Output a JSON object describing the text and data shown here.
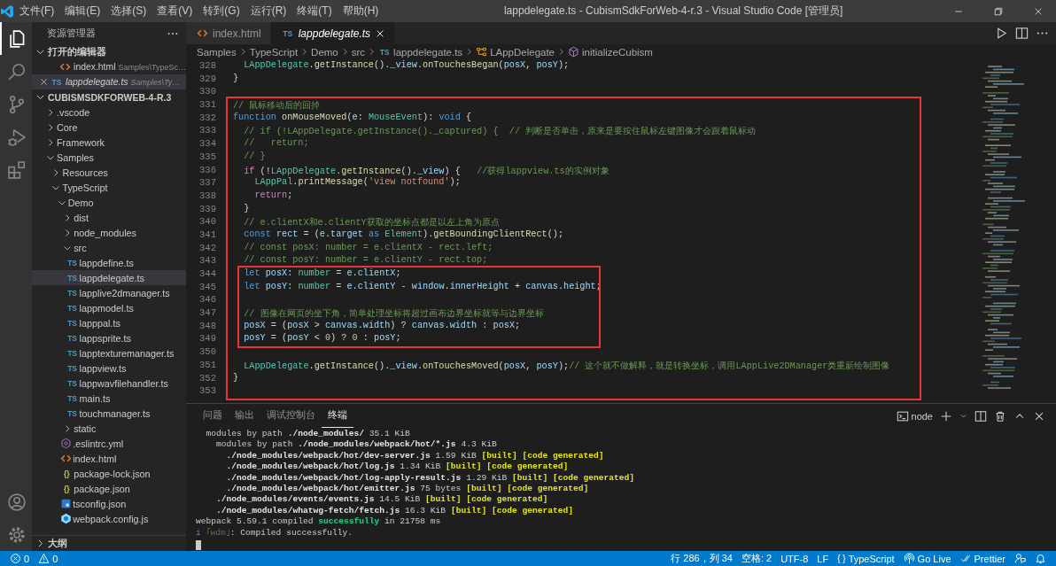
{
  "window": {
    "title": "lappdelegate.ts - CubismSdkForWeb-4-r.3 - Visual Studio Code [管理员]"
  },
  "menu": [
    "文件(F)",
    "编辑(E)",
    "选择(S)",
    "查看(V)",
    "转到(G)",
    "运行(R)",
    "终端(T)",
    "帮助(H)"
  ],
  "activity_bar": {
    "top": [
      {
        "kind": "explorer",
        "selected": true
      },
      {
        "kind": "search",
        "selected": false
      },
      {
        "kind": "scm",
        "selected": false
      },
      {
        "kind": "debug",
        "selected": false
      },
      {
        "kind": "extensions",
        "selected": false
      }
    ],
    "bottom": [
      {
        "kind": "account"
      },
      {
        "kind": "settings"
      }
    ]
  },
  "sidebar": {
    "title": "资源管理器",
    "open_editors": {
      "title": "打开的编辑器",
      "expanded": true,
      "items": [
        {
          "label": "index.html",
          "description": "Samples\\TypeSc…",
          "kind": "html",
          "preview": false,
          "selected": false
        },
        {
          "label": "lappdelegate.ts",
          "description": "Samples\\Ty…",
          "kind": "ts",
          "icon_label": "TS",
          "preview": true,
          "selected": true
        }
      ]
    },
    "folder": {
      "title": "CUBISMSDKFORWEB-4-R.3",
      "expanded": true,
      "tree": [
        {
          "label": ".vscode",
          "kind": "folder",
          "expanded": false,
          "selected": false
        },
        {
          "label": "Core",
          "kind": "folder",
          "expanded": false,
          "selected": false
        },
        {
          "label": "Framework",
          "kind": "folder",
          "expanded": false,
          "selected": false
        },
        {
          "label": "Samples",
          "kind": "folder",
          "expanded": true,
          "selected": false,
          "children": [
            {
              "label": "Resources",
              "kind": "folder",
              "expanded": false,
              "selected": false
            },
            {
              "label": "TypeScript",
              "kind": "folder",
              "expanded": true,
              "selected": false,
              "children": [
                {
                  "label": "Demo",
                  "kind": "folder",
                  "expanded": true,
                  "selected": false,
                  "children": [
                    {
                      "label": "dist",
                      "kind": "folder",
                      "expanded": false,
                      "selected": false
                    },
                    {
                      "label": "node_modules",
                      "kind": "folder",
                      "expanded": false,
                      "selected": false
                    },
                    {
                      "label": "src",
                      "kind": "folder",
                      "expanded": true,
                      "selected": false,
                      "children": [
                        {
                          "label": "lappdefine.ts",
                          "kind": "ts",
                          "icon_label": "TS",
                          "selected": false
                        },
                        {
                          "label": "lappdelegate.ts",
                          "kind": "ts",
                          "icon_label": "TS",
                          "selected": true
                        },
                        {
                          "label": "lapplive2dmanager.ts",
                          "kind": "ts",
                          "icon_label": "TS",
                          "selected": false
                        },
                        {
                          "label": "lappmodel.ts",
                          "kind": "ts",
                          "icon_label": "TS",
                          "selected": false
                        },
                        {
                          "label": "lapppal.ts",
                          "kind": "ts",
                          "icon_label": "TS",
                          "selected": false
                        },
                        {
                          "label": "lappsprite.ts",
                          "kind": "ts",
                          "icon_label": "TS",
                          "selected": false
                        },
                        {
                          "label": "lapptexturemanager.ts",
                          "kind": "ts",
                          "icon_label": "TS",
                          "selected": false
                        },
                        {
                          "label": "lappview.ts",
                          "kind": "ts",
                          "icon_label": "TS",
                          "selected": false
                        },
                        {
                          "label": "lappwavfilehandler.ts",
                          "kind": "ts",
                          "icon_label": "TS",
                          "selected": false
                        },
                        {
                          "label": "main.ts",
                          "kind": "ts",
                          "icon_label": "TS",
                          "selected": false
                        },
                        {
                          "label": "touchmanager.ts",
                          "kind": "ts",
                          "icon_label": "TS",
                          "selected": false
                        }
                      ]
                    },
                    {
                      "label": "static",
                      "kind": "folder",
                      "expanded": false,
                      "selected": false
                    },
                    {
                      "label": ".eslintrc.yml",
                      "kind": "yml",
                      "selected": false
                    },
                    {
                      "label": "index.html",
                      "kind": "html",
                      "selected": false
                    },
                    {
                      "label": "package-lock.json",
                      "kind": "json",
                      "icon_label": "{}",
                      "selected": false
                    },
                    {
                      "label": "package.json",
                      "kind": "json",
                      "icon_label": "{}",
                      "selected": false
                    },
                    {
                      "label": "tsconfig.json",
                      "kind": "tsconfig",
                      "selected": false
                    },
                    {
                      "label": "webpack.config.js",
                      "kind": "webpack",
                      "selected": false
                    }
                  ]
                }
              ]
            }
          ]
        }
      ]
    },
    "outline": {
      "title": "大纲",
      "expanded": false
    }
  },
  "editor": {
    "tabs": [
      {
        "label": "index.html",
        "kind": "html",
        "preview": false,
        "selected": false
      },
      {
        "label": "lappdelegate.ts",
        "kind": "ts",
        "icon_label": "TS",
        "preview": true,
        "selected": true
      }
    ],
    "breadcrumb": [
      {
        "label": "Samples",
        "kind": "path"
      },
      {
        "label": "TypeScript",
        "kind": "path"
      },
      {
        "label": "Demo",
        "kind": "path"
      },
      {
        "label": "src",
        "kind": "path"
      },
      {
        "label": "lappdelegate.ts",
        "kind": "ts",
        "icon_label": "TS"
      },
      {
        "label": "LAppDelegate",
        "kind": "class"
      },
      {
        "label": "initializeCubism",
        "kind": "method"
      }
    ],
    "code": [
      {
        "kind": "line",
        "number": "328",
        "tokens": [
          {
            "kind": "type",
            "text": "  LAppDelegate"
          },
          {
            "kind": "plain",
            "text": "."
          },
          {
            "kind": "function",
            "text": "getInstance"
          },
          {
            "kind": "plain",
            "text": "()."
          },
          {
            "kind": "variable",
            "text": "_view"
          },
          {
            "kind": "plain",
            "text": "."
          },
          {
            "kind": "function",
            "text": "onTouchesBegan"
          },
          {
            "kind": "plain",
            "text": "("
          },
          {
            "kind": "variable",
            "text": "posX"
          },
          {
            "kind": "plain",
            "text": ", "
          },
          {
            "kind": "variable",
            "text": "posY"
          },
          {
            "kind": "plain",
            "text": ");"
          }
        ]
      },
      {
        "kind": "line",
        "number": "329",
        "tokens": [
          {
            "kind": "plain",
            "text": "}"
          }
        ]
      },
      {
        "kind": "line",
        "number": "330"
      },
      {
        "kind": "box",
        "items": [
          {
            "kind": "line",
            "number": "331",
            "tokens": [
              {
                "kind": "comment",
                "text": "// 鼠标移动后的回掉"
              }
            ]
          },
          {
            "kind": "line",
            "number": "332",
            "tokens": [
              {
                "kind": "keyword",
                "text": "function"
              },
              {
                "kind": "function",
                "text": " onMouseMoved"
              },
              {
                "kind": "plain",
                "text": "("
              },
              {
                "kind": "variable",
                "text": "e"
              },
              {
                "kind": "plain",
                "text": ": "
              },
              {
                "kind": "type",
                "text": "MouseEvent"
              },
              {
                "kind": "plain",
                "text": "): "
              },
              {
                "kind": "keyword",
                "text": "void"
              },
              {
                "kind": "plain",
                "text": " {"
              }
            ]
          },
          {
            "kind": "line",
            "number": "333",
            "tokens": [
              {
                "kind": "comment",
                "text": "  // if (!LAppDelegate.getInstance()._captured) {  // 判断是否单击，原来是要按住鼠标左键图像才会跟着鼠标动"
              }
            ]
          },
          {
            "kind": "line",
            "number": "334",
            "tokens": [
              {
                "kind": "comment",
                "text": "  //   return;"
              }
            ]
          },
          {
            "kind": "line",
            "number": "335",
            "tokens": [
              {
                "kind": "comment",
                "text": "  // }"
              }
            ]
          },
          {
            "kind": "line",
            "number": "336",
            "tokens": [
              {
                "kind": "control",
                "text": "  if"
              },
              {
                "kind": "plain",
                "text": " (!"
              },
              {
                "kind": "type",
                "text": "LAppDelegate"
              },
              {
                "kind": "plain",
                "text": "."
              },
              {
                "kind": "function",
                "text": "getInstance"
              },
              {
                "kind": "plain",
                "text": "()."
              },
              {
                "kind": "variable",
                "text": "_view"
              },
              {
                "kind": "plain",
                "text": ") {   "
              },
              {
                "kind": "comment",
                "text": "//获得lappview.ts的实例对象"
              }
            ]
          },
          {
            "kind": "line",
            "number": "337",
            "tokens": [
              {
                "kind": "type",
                "text": "    LAppPal"
              },
              {
                "kind": "plain",
                "text": "."
              },
              {
                "kind": "function",
                "text": "printMessage"
              },
              {
                "kind": "plain",
                "text": "("
              },
              {
                "kind": "string",
                "text": "'view notfound'"
              },
              {
                "kind": "plain",
                "text": ");"
              }
            ]
          },
          {
            "kind": "line",
            "number": "338",
            "tokens": [
              {
                "kind": "control",
                "text": "    return"
              },
              {
                "kind": "plain",
                "text": ";"
              }
            ]
          },
          {
            "kind": "line",
            "number": "339",
            "tokens": [
              {
                "kind": "plain",
                "text": "  }"
              }
            ]
          },
          {
            "kind": "line",
            "number": "340",
            "tokens": [
              {
                "kind": "comment",
                "text": "  // e.clientX和e.clientY获取的坐标点都是以左上角为原点"
              }
            ]
          },
          {
            "kind": "line",
            "number": "341",
            "tokens": [
              {
                "kind": "keyword",
                "text": "  const"
              },
              {
                "kind": "variable",
                "text": " rect"
              },
              {
                "kind": "plain",
                "text": " = ("
              },
              {
                "kind": "variable",
                "text": "e"
              },
              {
                "kind": "plain",
                "text": "."
              },
              {
                "kind": "variable",
                "text": "target"
              },
              {
                "kind": "keyword",
                "text": " as"
              },
              {
                "kind": "type",
                "text": " Element"
              },
              {
                "kind": "plain",
                "text": ")."
              },
              {
                "kind": "function",
                "text": "getBoundingClientRect"
              },
              {
                "kind": "plain",
                "text": "();"
              }
            ]
          },
          {
            "kind": "line",
            "number": "342",
            "tokens": [
              {
                "kind": "comment",
                "text": "  // const posX: number = e.clientX - rect.left;"
              }
            ]
          },
          {
            "kind": "line",
            "number": "343",
            "tokens": [
              {
                "kind": "comment",
                "text": "  // const posY: number = e.clientY - rect.top;"
              }
            ]
          },
          {
            "kind": "box",
            "items": [
              {
                "kind": "line",
                "number": "344",
                "tokens": [
                  {
                    "kind": "keyword",
                    "text": "  let"
                  },
                  {
                    "kind": "variable",
                    "text": " posX"
                  },
                  {
                    "kind": "plain",
                    "text": ": "
                  },
                  {
                    "kind": "type",
                    "text": "number"
                  },
                  {
                    "kind": "plain",
                    "text": " = "
                  },
                  {
                    "kind": "variable",
                    "text": "e"
                  },
                  {
                    "kind": "plain",
                    "text": "."
                  },
                  {
                    "kind": "variable",
                    "text": "clientX"
                  },
                  {
                    "kind": "plain",
                    "text": ";"
                  }
                ]
              },
              {
                "kind": "line",
                "number": "345",
                "tokens": [
                  {
                    "kind": "keyword",
                    "text": "  let"
                  },
                  {
                    "kind": "variable",
                    "text": " posY"
                  },
                  {
                    "kind": "plain",
                    "text": ": "
                  },
                  {
                    "kind": "type",
                    "text": "number"
                  },
                  {
                    "kind": "plain",
                    "text": " = "
                  },
                  {
                    "kind": "variable",
                    "text": "e"
                  },
                  {
                    "kind": "plain",
                    "text": "."
                  },
                  {
                    "kind": "variable",
                    "text": "clientY"
                  },
                  {
                    "kind": "plain",
                    "text": " - "
                  },
                  {
                    "kind": "variable",
                    "text": "window"
                  },
                  {
                    "kind": "plain",
                    "text": "."
                  },
                  {
                    "kind": "variable",
                    "text": "innerHeight"
                  },
                  {
                    "kind": "plain",
                    "text": " + "
                  },
                  {
                    "kind": "variable",
                    "text": "canvas"
                  },
                  {
                    "kind": "plain",
                    "text": "."
                  },
                  {
                    "kind": "variable",
                    "text": "height"
                  },
                  {
                    "kind": "plain",
                    "text": ";"
                  }
                ]
              },
              {
                "kind": "line",
                "number": "346"
              },
              {
                "kind": "line",
                "number": "347",
                "tokens": [
                  {
                    "kind": "comment",
                    "text": "  // 图像在网页的坐下角，简单处理坐标将超过画布边界坐标就等与边界坐标"
                  }
                ]
              },
              {
                "kind": "line",
                "number": "348",
                "tokens": [
                  {
                    "kind": "variable",
                    "text": "  posX"
                  },
                  {
                    "kind": "plain",
                    "text": " = ("
                  },
                  {
                    "kind": "variable",
                    "text": "posX"
                  },
                  {
                    "kind": "plain",
                    "text": " > "
                  },
                  {
                    "kind": "variable",
                    "text": "canvas"
                  },
                  {
                    "kind": "plain",
                    "text": "."
                  },
                  {
                    "kind": "variable",
                    "text": "width"
                  },
                  {
                    "kind": "plain",
                    "text": ") ? "
                  },
                  {
                    "kind": "variable",
                    "text": "canvas"
                  },
                  {
                    "kind": "plain",
                    "text": "."
                  },
                  {
                    "kind": "variable",
                    "text": "width"
                  },
                  {
                    "kind": "plain",
                    "text": " : "
                  },
                  {
                    "kind": "variable",
                    "text": "posX"
                  },
                  {
                    "kind": "plain",
                    "text": ";"
                  }
                ]
              },
              {
                "kind": "line",
                "number": "349",
                "tokens": [
                  {
                    "kind": "variable",
                    "text": "  posY"
                  },
                  {
                    "kind": "plain",
                    "text": " = ("
                  },
                  {
                    "kind": "variable",
                    "text": "posY"
                  },
                  {
                    "kind": "plain",
                    "text": " < "
                  },
                  {
                    "kind": "number",
                    "text": "0"
                  },
                  {
                    "kind": "plain",
                    "text": ") ? "
                  },
                  {
                    "kind": "number",
                    "text": "0"
                  },
                  {
                    "kind": "plain",
                    "text": " : "
                  },
                  {
                    "kind": "variable",
                    "text": "posY"
                  },
                  {
                    "kind": "plain",
                    "text": ";"
                  }
                ]
              }
            ]
          },
          {
            "kind": "line",
            "number": "350"
          },
          {
            "kind": "line",
            "number": "351",
            "tokens": [
              {
                "kind": "type",
                "text": "  LAppDelegate"
              },
              {
                "kind": "plain",
                "text": "."
              },
              {
                "kind": "function",
                "text": "getInstance"
              },
              {
                "kind": "plain",
                "text": "()."
              },
              {
                "kind": "variable",
                "text": "_view"
              },
              {
                "kind": "plain",
                "text": "."
              },
              {
                "kind": "function",
                "text": "onTouchesMoved"
              },
              {
                "kind": "plain",
                "text": "("
              },
              {
                "kind": "variable",
                "text": "posX"
              },
              {
                "kind": "plain",
                "text": ", "
              },
              {
                "kind": "variable",
                "text": "posY"
              },
              {
                "kind": "plain",
                "text": ");"
              },
              {
                "kind": "comment",
                "text": "// 这个就不做解释，就是转换坐标，调用LAppLive2DManager类重新绘制图像"
              }
            ]
          },
          {
            "kind": "line",
            "number": "352",
            "tokens": [
              {
                "kind": "plain",
                "text": "}"
              }
            ]
          },
          {
            "kind": "line",
            "number": "353"
          }
        ]
      }
    ]
  },
  "panel": {
    "tabs": [
      {
        "label": "问题",
        "selected": false
      },
      {
        "label": "输出",
        "selected": false
      },
      {
        "label": "调试控制台",
        "selected": false
      },
      {
        "label": "终端",
        "selected": true
      }
    ],
    "terminal_name": "node",
    "terminal": [
      [
        {
          "kind": "plain",
          "text": "  modules by path "
        },
        {
          "kind": "bold",
          "text": "./node_modules/"
        },
        {
          "kind": "plain",
          "text": " 35.1 KiB"
        }
      ],
      [
        {
          "kind": "plain",
          "text": "    modules by path "
        },
        {
          "kind": "bold",
          "text": "./node_modules/webpack/hot/*.js"
        },
        {
          "kind": "plain",
          "text": " 4.3 KiB"
        }
      ],
      [
        {
          "kind": "bold",
          "text": "      ./node_modules/webpack/hot/dev-server.js"
        },
        {
          "kind": "plain",
          "text": " 1.59 KiB "
        },
        {
          "kind": "yellow",
          "text": "[built] [code generated]"
        }
      ],
      [
        {
          "kind": "bold",
          "text": "      ./node_modules/webpack/hot/log.js"
        },
        {
          "kind": "plain",
          "text": " 1.34 KiB "
        },
        {
          "kind": "yellow",
          "text": "[built] [code generated]"
        }
      ],
      [
        {
          "kind": "bold",
          "text": "      ./node_modules/webpack/hot/log-apply-result.js"
        },
        {
          "kind": "plain",
          "text": " 1.29 KiB "
        },
        {
          "kind": "yellow",
          "text": "[built] [code generated]"
        }
      ],
      [
        {
          "kind": "bold",
          "text": "      ./node_modules/webpack/hot/emitter.js"
        },
        {
          "kind": "plain",
          "text": " 75 bytes "
        },
        {
          "kind": "yellow",
          "text": "[built] [code generated]"
        }
      ],
      [
        {
          "kind": "bold",
          "text": "    ./node_modules/events/events.js"
        },
        {
          "kind": "plain",
          "text": " 14.5 KiB "
        },
        {
          "kind": "yellow",
          "text": "[built] [code generated]"
        }
      ],
      [
        {
          "kind": "bold",
          "text": "    ./node_modules/whatwg-fetch/fetch.js"
        },
        {
          "kind": "plain",
          "text": " 16.3 KiB "
        },
        {
          "kind": "yellow",
          "text": "[built] [code generated]"
        }
      ],
      [
        {
          "kind": "plain",
          "text": "webpack 5.59.1 compiled "
        },
        {
          "kind": "green",
          "text": "successfully"
        },
        {
          "kind": "plain",
          "text": " in 21758 ms"
        }
      ],
      [
        {
          "kind": "info",
          "text": "i"
        },
        {
          "kind": "dim",
          "text": " ｢wdm｣"
        },
        {
          "kind": "plain",
          "text": ": Compiled successfully."
        }
      ]
    ]
  },
  "status_bar": {
    "left": [
      {
        "kind": "errors",
        "text": "0"
      },
      {
        "kind": "warnings",
        "text": "0"
      }
    ],
    "right": [
      {
        "kind": "text",
        "text": "行 286，列 34"
      },
      {
        "kind": "text",
        "text": "空格: 2"
      },
      {
        "kind": "text",
        "text": "UTF-8"
      },
      {
        "kind": "text",
        "text": "LF"
      },
      {
        "kind": "language",
        "icon_label": "{ }",
        "text": "TypeScript"
      },
      {
        "kind": "broadcast",
        "text": "Go Live"
      },
      {
        "kind": "checks",
        "text": "Prettier"
      },
      {
        "kind": "feedback"
      },
      {
        "kind": "bell"
      }
    ]
  }
}
